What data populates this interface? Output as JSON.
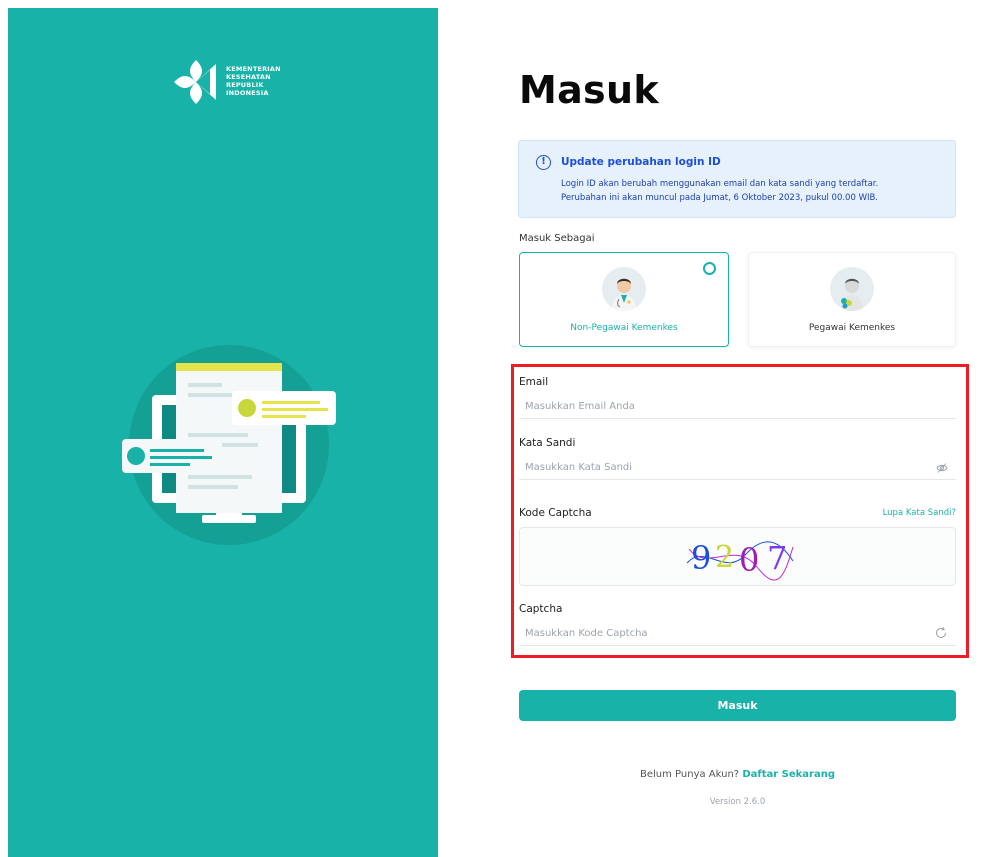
{
  "brand": {
    "logo_lines": [
      "KEMENTERIAN",
      "KESEHATAN",
      "REPUBLIK",
      "INDONESIA"
    ],
    "primary_color": "#18b2a8"
  },
  "page_title": "Masuk",
  "notice": {
    "title": "Update perubahan login ID",
    "line1": "Login ID akan berubah menggunakan email dan kata sandi yang terdaftar.",
    "line2": "Perubahan ini akan muncul pada Jumat, 6 Oktober 2023, pukul 00.00 WIB.",
    "icon": "info-icon",
    "color": "#1d4ed8"
  },
  "role": {
    "label": "Masuk Sebagai",
    "options": [
      {
        "name": "Non-Pegawai Kemenkes",
        "selected": true
      },
      {
        "name": "Pegawai Kemenkes",
        "selected": false
      }
    ]
  },
  "form": {
    "email_label": "Email",
    "email_placeholder": "Masukkan Email Anda",
    "password_label": "Kata Sandi",
    "password_placeholder": "Masukkan Kata Sandi",
    "forgot_password": "Lupa Kata Sandi?",
    "captcha_image_label": "Kode Captcha",
    "captcha_code": "9207",
    "captcha_label": "Captcha",
    "captcha_placeholder": "Masukkan Kode Captcha",
    "submit_label": "Masuk"
  },
  "footer": {
    "signup_prompt": "Belum Punya Akun?",
    "signup_link": "Daftar Sekarang",
    "version": "Version 2.6.0"
  },
  "highlight_color": "#ee1c24"
}
